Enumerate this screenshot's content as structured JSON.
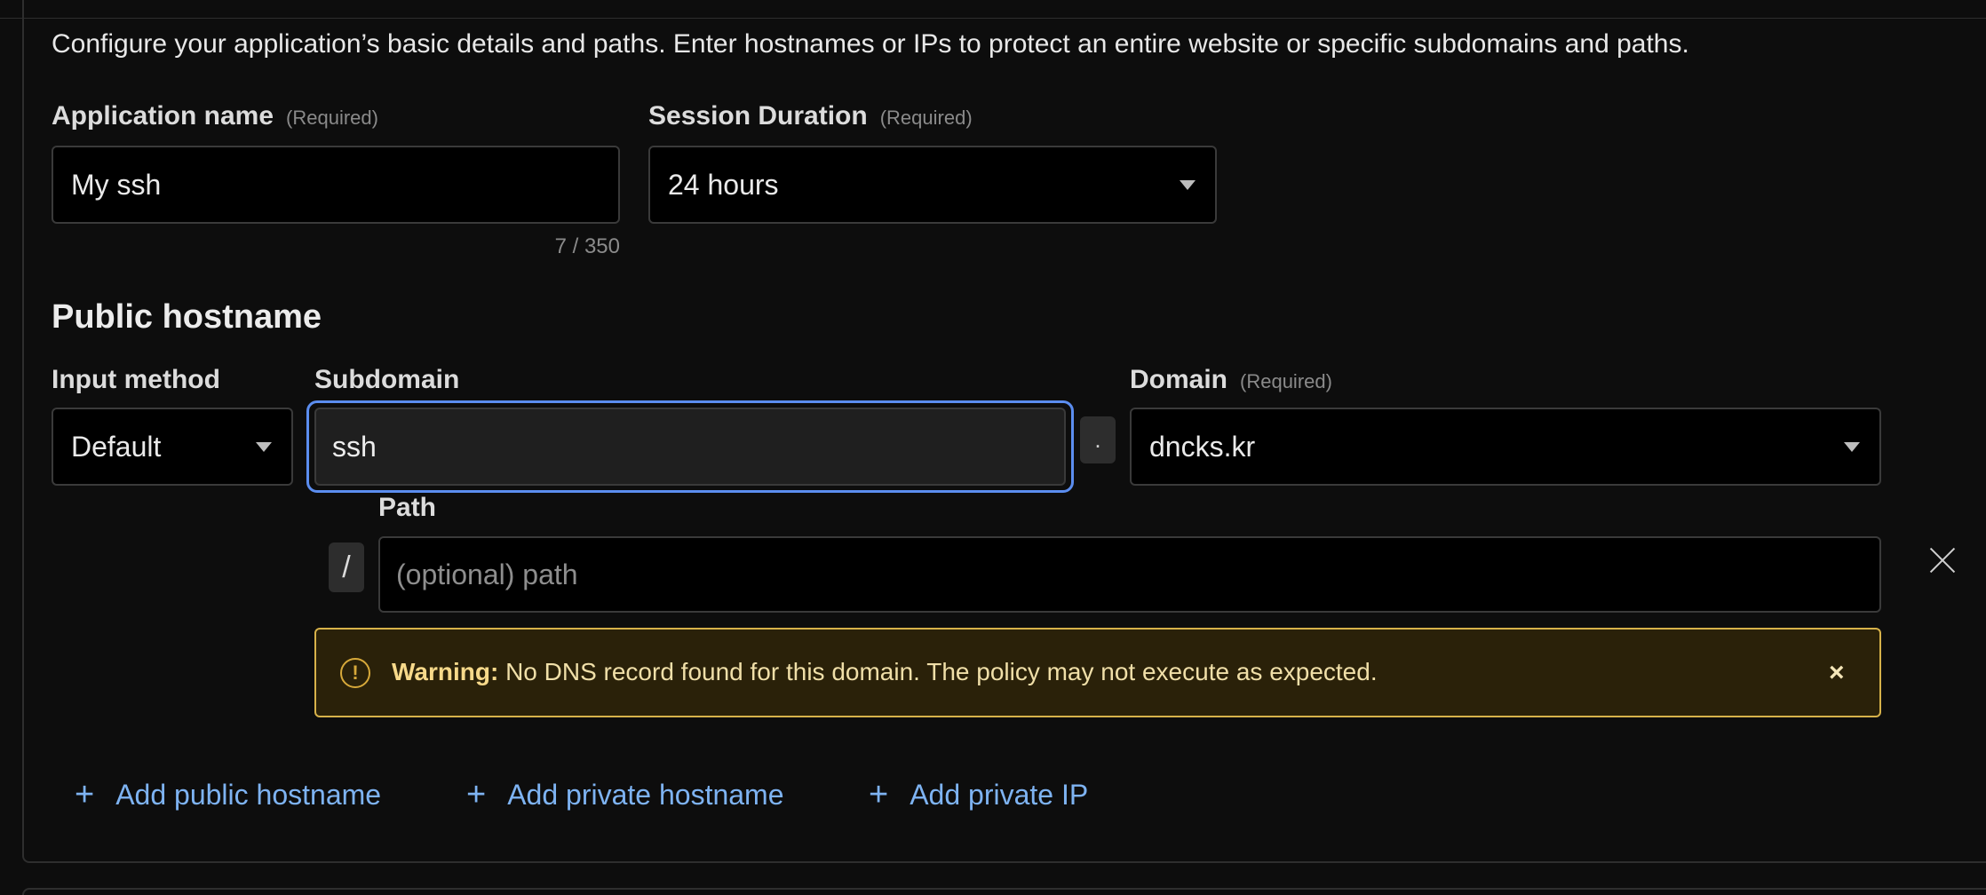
{
  "intro": "Configure your application’s basic details and paths. Enter hostnames or IPs to protect an entire website or specific subdomains and paths.",
  "application_name": {
    "label": "Application name",
    "required": "(Required)",
    "value": "My ssh",
    "counter": "7 / 350"
  },
  "session_duration": {
    "label": "Session Duration",
    "required": "(Required)",
    "value": "24 hours"
  },
  "public_hostname": {
    "title": "Public hostname",
    "input_method": {
      "label": "Input method",
      "value": "Default"
    },
    "subdomain": {
      "label": "Subdomain",
      "value": "ssh"
    },
    "separator": ".",
    "domain": {
      "label": "Domain",
      "required": "(Required)",
      "value": "dncks.kr"
    },
    "path": {
      "label": "Path",
      "prefix": "/",
      "placeholder": "(optional) path"
    }
  },
  "warning": {
    "icon": "!",
    "strong": "Warning:",
    "message": "No DNS record found for this domain. The policy may not execute as expected.",
    "close": "×"
  },
  "actions": {
    "plus": "+",
    "add_public_hostname": "Add public hostname",
    "add_private_hostname": "Add private hostname",
    "add_private_ip": "Add private IP"
  },
  "colors": {
    "accent_link": "#7eb3f2",
    "focus_ring": "#5b8def",
    "warning_border": "#d7b24a",
    "warning_bg": "#2a2109",
    "background": "#0d0d0d"
  }
}
